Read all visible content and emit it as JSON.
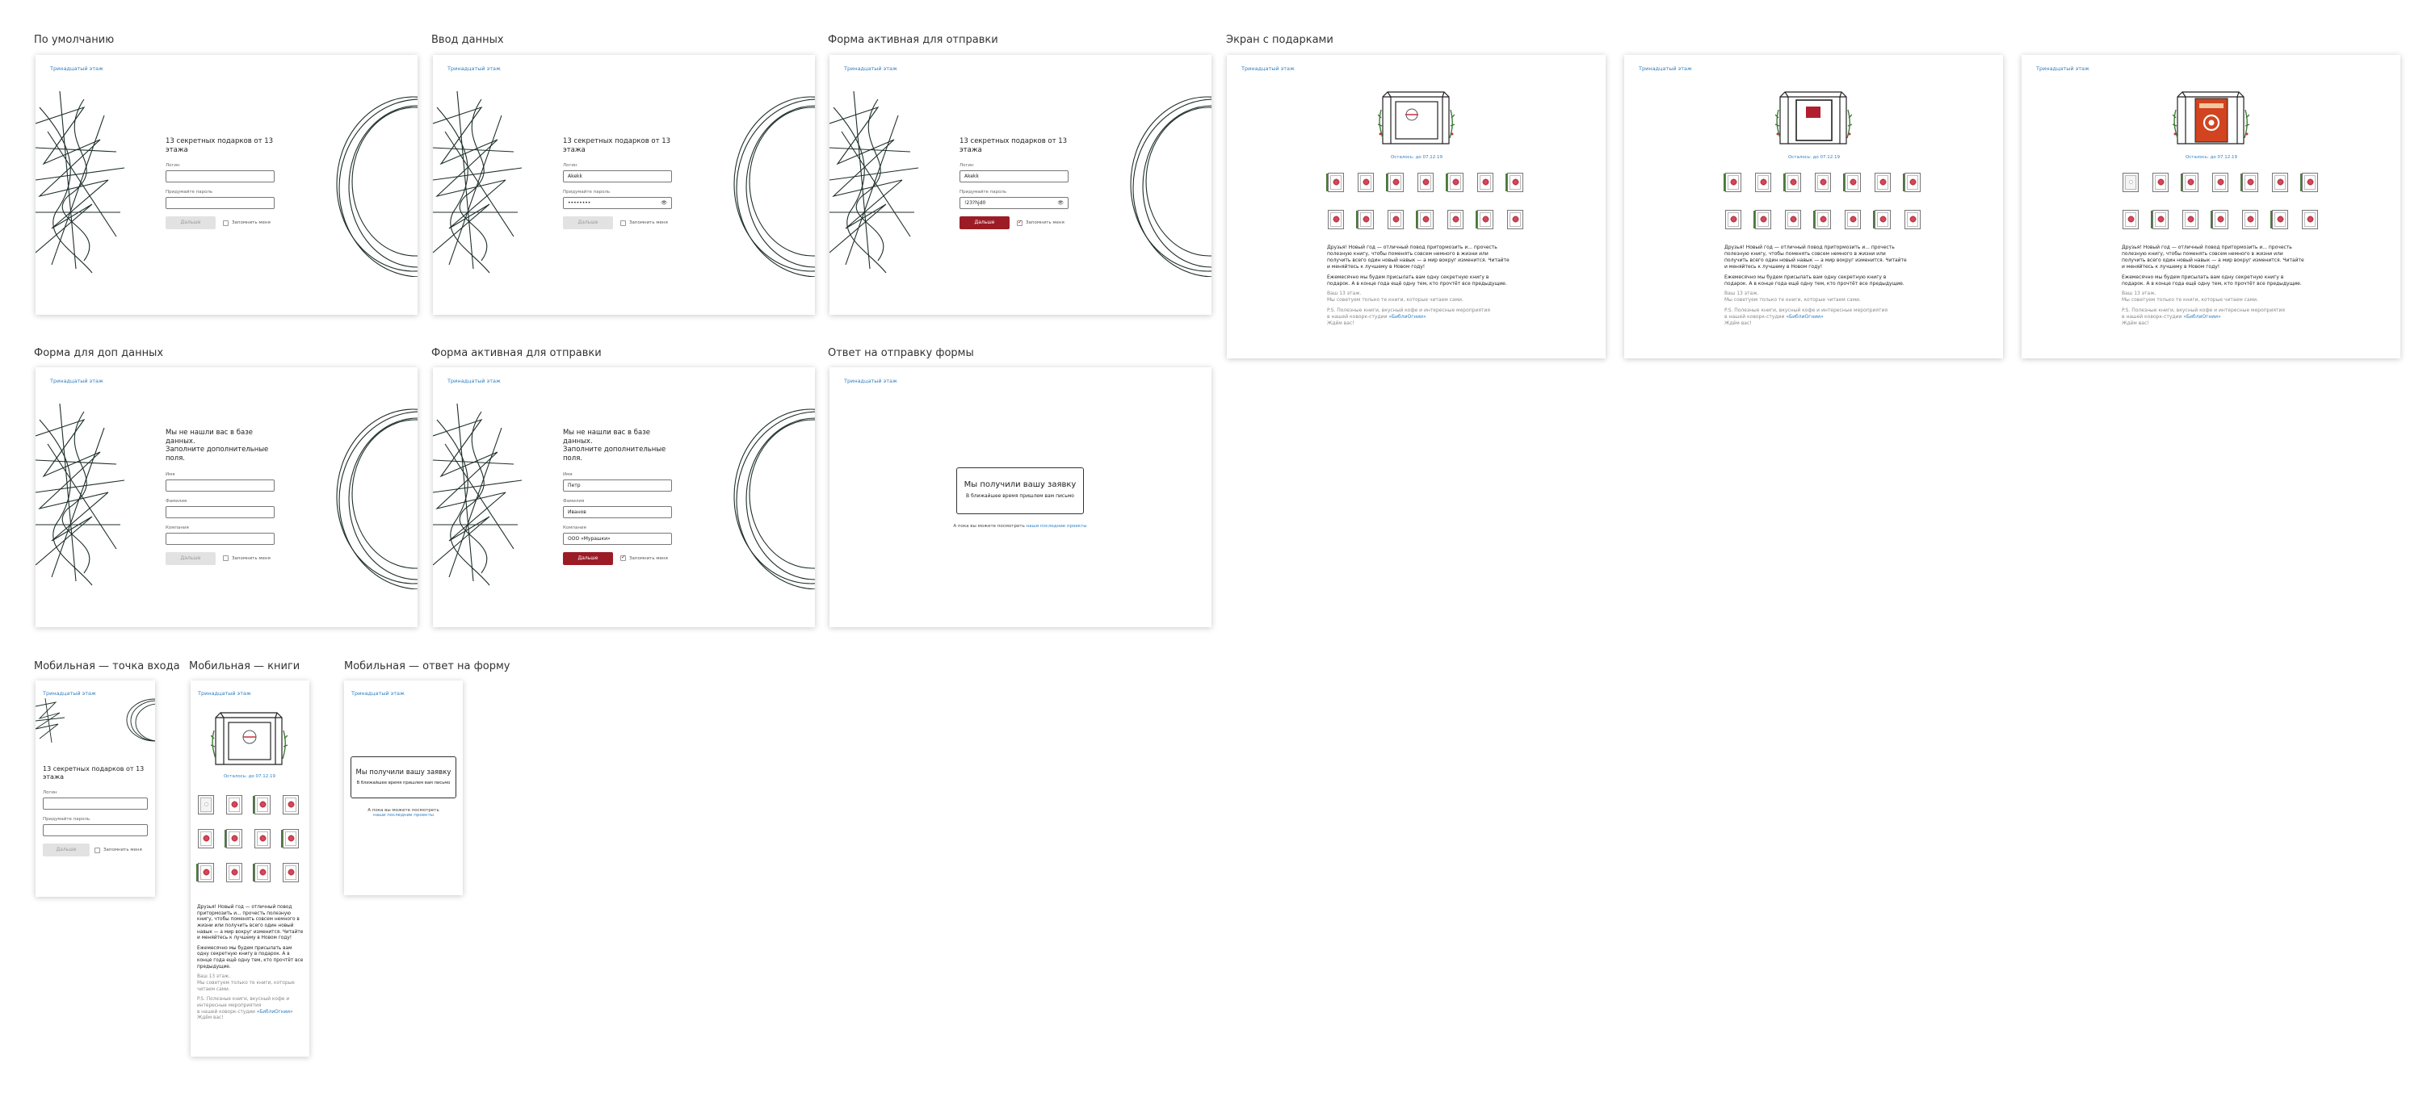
{
  "sections": {
    "default": "По умолчанию",
    "input": "Ввод данных",
    "form_active": "Форма активная для отправки",
    "gifts": "Экран с подарками",
    "extra": "Форма для доп данных",
    "extra_active": "Форма активная для отправки",
    "reply": "Ответ на отправку формы",
    "mob_entry": "Мобильная — точка входа",
    "mob_books": "Мобильная — книги",
    "mob_reply": "Мобильная — ответ на форму"
  },
  "brand": "Тринадцатый этаж",
  "login": {
    "title": "13 секретных подарков от 13 этажа",
    "login_label": "Логин",
    "password_label": "Придумайте пароль",
    "login_value": "Akekk",
    "password_masked": "••••••••",
    "password_visible": "!23?hjd0",
    "eye_icon": "👁"
  },
  "extra": {
    "title_line1": "Мы не нашли вас в базе данных.",
    "title_line2": "Заполните дополнительные поля.",
    "name_label": "Имя",
    "surname_label": "Фамилия",
    "company_label": "Компания",
    "name_value": "Петр",
    "surname_value": "Иванов",
    "company_value": "ООО «Мурашки»"
  },
  "buttons": {
    "next": "Дальше",
    "remember": "Запомнить меня"
  },
  "reply": {
    "title": "Мы получили вашу заявку",
    "subtitle": "В ближайшее время пришлем вам письмо",
    "after_prefix": "А пока вы можете посмотреть",
    "after_link": "наши последние проекты"
  },
  "gifts": {
    "date": "Осталось: до 07.12.19",
    "p1": "Друзья! Новый год — отличный повод притормозить и... прочесть полезную книгу, чтобы поменять совсем немного в жизни или получить всего один новый навык — а мир вокруг изменится. Читайте и меняйтесь к лучшему в Новом году!",
    "p2": "Ежемесячно мы будем присылать вам одну секретную книгу в подарок. А в конце года ещё одну тем, кто прочтёт все предыдущие.",
    "p3a": "Ваш 13 этаж.",
    "p3b": "Мы советуем только те книги, которые читаем сами.",
    "p4a": "P.S. Полезные книги, вкусный кофе и интересные мероприятия",
    "p4b": "в нашей коворк-студии",
    "p4link": "«БиблиОгнии»",
    "p4c": "Ждём вас!"
  }
}
